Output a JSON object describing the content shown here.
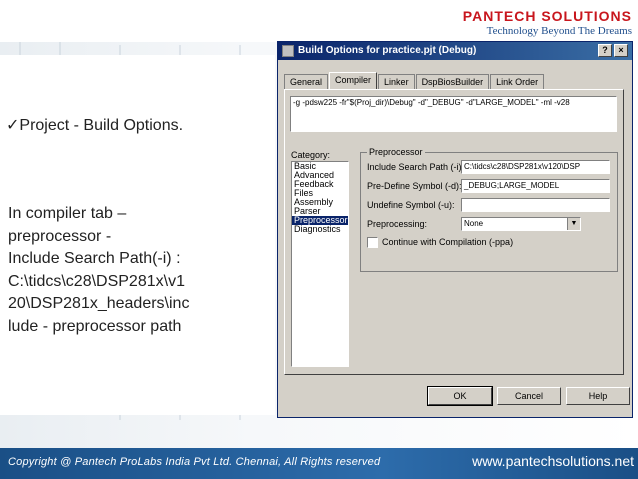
{
  "logo": {
    "name": "PANTECH SOLUTIONS",
    "tagline": "Technology Beyond The Dreams"
  },
  "slide": {
    "bullet_check": "✓",
    "bullet_text": "Project - Build Options.",
    "body_lines": [
      "In compiler tab –",
      "preprocessor -",
      "Include Search Path(-i) :",
      "C:\\tidcs\\c28\\DSP281x\\v1",
      "20\\DSP281x_headers\\inc",
      "lude - preprocessor path"
    ]
  },
  "dialog": {
    "title": "Build Options for practice.pjt (Debug)",
    "help_btn": "?",
    "close_btn": "×",
    "tabs": [
      "General",
      "Compiler",
      "Linker",
      "DspBiosBuilder",
      "Link Order"
    ],
    "active_tab": "Compiler",
    "command_line": "-g -pdsw225 -fr\"$(Proj_dir)\\Debug\" -d\"_DEBUG\" -d\"LARGE_MODEL\" -ml -v28",
    "category_label": "Category:",
    "categories": [
      "Basic",
      "Advanced",
      "Feedback",
      "Files",
      "Assembly",
      "Parser",
      "Preprocessor",
      "Diagnostics"
    ],
    "selected_category": "Preprocessor",
    "group_title": "Preprocessor",
    "include_label": "Include Search Path (-i):",
    "include_value": "C:\\tidcs\\c28\\DSP281x\\v120\\DSP",
    "predefine_label": "Pre-Define Symbol (-d):",
    "predefine_value": "_DEBUG;LARGE_MODEL",
    "undefine_label": "Undefine Symbol (-u):",
    "undefine_value": "",
    "preprocessing_label": "Preprocessing:",
    "preprocessing_value": "None",
    "continue_label": "Continue with Compilation (-ppa)",
    "ok": "OK",
    "cancel": "Cancel",
    "help": "Help"
  },
  "footer": {
    "copyright": "Copyright @ Pantech ProLabs India Pvt Ltd. Chennai, All Rights reserved",
    "website": "www.pantechsolutions.net"
  }
}
